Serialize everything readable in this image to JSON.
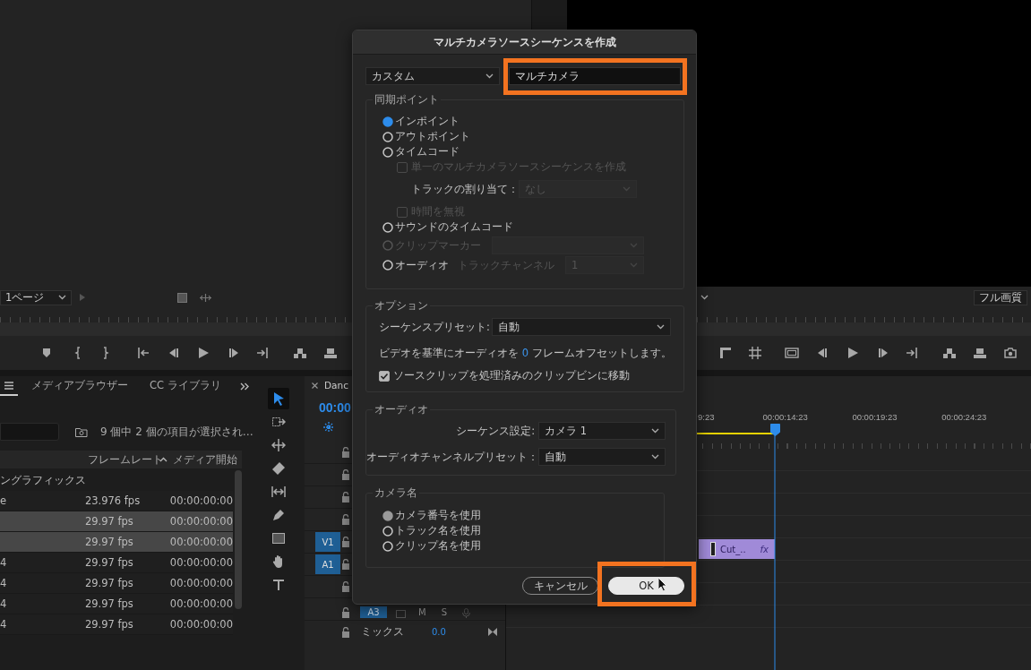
{
  "source_monitor": {
    "page_select": "1ページ"
  },
  "program_monitor": {
    "quality": "フル画質"
  },
  "project": {
    "tabs": [
      {
        "kind": "menu",
        "selected": true
      },
      {
        "kind": "text",
        "label": "メディアブラウザー",
        "selected": false
      },
      {
        "kind": "text",
        "label": "CC ライブラリ",
        "selected": false
      }
    ],
    "status": "9 個中 2 個の項目が選択され…",
    "columns": [
      "フレームレート",
      "メディア開始"
    ],
    "group": "ングラフィックス",
    "rows": [
      {
        "name": "e",
        "rate": "23.976 fps",
        "start": "00:00:00:00",
        "selected": false
      },
      {
        "rate": "29.97 fps",
        "start": "00:00:00:00",
        "selected": true
      },
      {
        "rate": "29.97 fps",
        "start": "00:00:00:00",
        "selected": true
      },
      {
        "name": "4",
        "rate": "29.97 fps",
        "start": "00:00:00:00",
        "selected": false
      },
      {
        "name": "4",
        "rate": "29.97 fps",
        "start": "00:00:00:00",
        "selected": false
      },
      {
        "name": "4",
        "rate": "29.97 fps",
        "start": "00:00:00:00",
        "selected": false
      },
      {
        "name": "4",
        "rate": "29.97 fps",
        "start": "00:00:00:00",
        "selected": false
      }
    ]
  },
  "tools": [
    {
      "kind": "selection",
      "selected": true
    },
    {
      "kind": "track-select",
      "selected": false
    },
    {
      "kind": "ripple",
      "selected": false
    },
    {
      "kind": "razor",
      "selected": false
    },
    {
      "kind": "slip",
      "selected": false
    },
    {
      "kind": "pen",
      "selected": false
    },
    {
      "kind": "rectangle",
      "selected": false
    },
    {
      "kind": "hand",
      "selected": false
    },
    {
      "kind": "type",
      "selected": false
    }
  ],
  "timeline": {
    "tab": "Danc",
    "timecode": "00:00",
    "ruler": [
      "9:23",
      "00:00:14:23",
      "00:00:19:23",
      "00:00:24:23"
    ],
    "tracks": [
      {
        "locked": false
      },
      {
        "locked": false
      },
      {
        "locked": false
      },
      {
        "locked": false
      },
      {
        "locked": false,
        "source": "V1"
      },
      {
        "locked": false,
        "source": "A1"
      },
      {
        "locked": false
      },
      {
        "locked": false,
        "name": "A3",
        "mute": "M",
        "solo": "S"
      }
    ],
    "mix": {
      "label": "ミックス",
      "value": "0.0",
      "locked": false
    },
    "clip": {
      "label": "Cut_..",
      "badge": "fx"
    }
  },
  "dialog": {
    "title": "マルチカメラソースシーケンスを作成",
    "preset": "カスタム",
    "name_value": "マルチカメラ",
    "sync": {
      "legend": "同期ポイント",
      "items": [
        {
          "kind": "radio",
          "label": "インポイント",
          "selected": true,
          "disabled": false
        },
        {
          "kind": "radio",
          "label": "アウトポイント",
          "selected": false,
          "disabled": false
        },
        {
          "kind": "radio",
          "label": "タイムコード",
          "selected": false,
          "disabled": false
        },
        {
          "kind": "checkbox",
          "label": "単一のマルチカメラソースシーケンスを作成",
          "checked": false,
          "disabled": true
        },
        {
          "kind": "select",
          "label": "トラックの割り当て：",
          "value": "なし",
          "disabled": true
        },
        {
          "kind": "checkbox",
          "label": "時間を無視",
          "checked": false,
          "disabled": true
        },
        {
          "kind": "radio",
          "label": "サウンドのタイムコード",
          "selected": false,
          "disabled": false
        },
        {
          "kind": "radio",
          "label": "クリップマーカー",
          "selected": false,
          "disabled": true,
          "select": {
            "disabled": true
          }
        },
        {
          "kind": "radio",
          "label": "オーディオ",
          "selected": false,
          "disabled": false,
          "sub_label": "トラックチャンネル",
          "select": {
            "value": "1",
            "disabled": true
          }
        }
      ]
    },
    "options": {
      "legend": "オプション",
      "preset_label": "シーケンスプリセット:",
      "preset_value": "自動",
      "offset_before": "ビデオを基準にオーディオを",
      "offset_value": "0",
      "offset_after": "フレームオフセットします。",
      "move_label": "ソースクリップを処理済みのクリップビンに移動",
      "move_checked": true
    },
    "audio": {
      "legend": "オーディオ",
      "rows": [
        {
          "label": "シーケンス設定:",
          "value": "カメラ 1"
        },
        {
          "label": "オーディオチャンネルプリセット：",
          "value": "自動"
        }
      ]
    },
    "camera_names": {
      "legend": "カメラ名",
      "items": [
        {
          "label": "カメラ番号を使用",
          "selected": true
        },
        {
          "label": "トラック名を使用",
          "selected": false
        },
        {
          "label": "クリップ名を使用",
          "selected": false
        }
      ]
    },
    "buttons": [
      {
        "kind": "cancel",
        "label": "キャンセル"
      },
      {
        "kind": "ok",
        "label": "OK"
      }
    ]
  }
}
